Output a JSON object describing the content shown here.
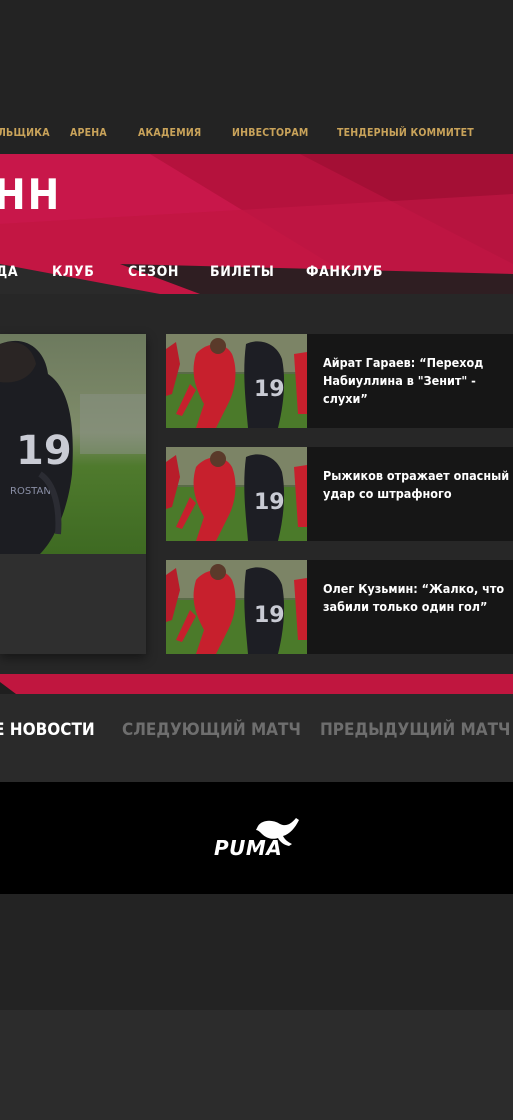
{
  "top_nav": {
    "items": [
      {
        "label": "ЛЬЩИКА"
      },
      {
        "label": "АРЕНА"
      },
      {
        "label": "АКАДЕМИЯ"
      },
      {
        "label": "ИНВЕСТОРАМ"
      },
      {
        "label": "ТЕНДЕРНЫЙ КОММИТЕТ"
      }
    ]
  },
  "banner": {
    "logo_text": "НН"
  },
  "main_nav": {
    "items": [
      {
        "label": "ДА"
      },
      {
        "label": "КЛУБ"
      },
      {
        "label": "СЕЗОН"
      },
      {
        "label": "БИЛЕТЫ"
      },
      {
        "label": "ФАНКЛУБ"
      }
    ]
  },
  "news": [
    {
      "title": "Айрат Гараев: “Переход Набиуллина в \"Зенит\" - слухи”"
    },
    {
      "title": "Рыжиков отражает опасный удар со штрафного"
    },
    {
      "title": "Олег Кузьмин: “Жалко, что забили только один гол”"
    }
  ],
  "tabs": [
    {
      "label": "Е НОВОСТИ",
      "active": true
    },
    {
      "label": "СЛЕДУЮЩИЙ МАТЧ",
      "active": false
    },
    {
      "label": "ПРЕДЫДУЩИЙ МАТЧ",
      "active": false
    }
  ],
  "sponsor": {
    "logo_text": "PUMA"
  },
  "colors": {
    "accent": "#c0163f",
    "nav_text": "#c9a35a",
    "background": "#272727"
  }
}
